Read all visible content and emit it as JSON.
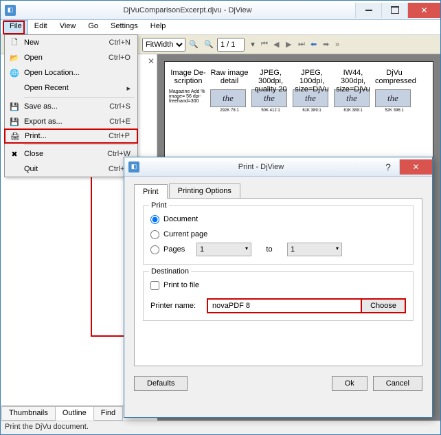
{
  "main": {
    "title": "DjVuComparisonExcerpt.djvu - DjView",
    "statusbar": "Print the DjVu document."
  },
  "menubar": {
    "file": "File",
    "edit": "Edit",
    "view": "View",
    "go": "Go",
    "settings": "Settings",
    "help": "Help"
  },
  "filemenu": {
    "new": {
      "label": "New",
      "shortcut": "Ctrl+N"
    },
    "open": {
      "label": "Open",
      "shortcut": "Ctrl+O"
    },
    "open_location": {
      "label": "Open Location..."
    },
    "open_recent": {
      "label": "Open Recent"
    },
    "save_as": {
      "label": "Save as...",
      "shortcut": "Ctrl+S"
    },
    "export_as": {
      "label": "Export as...",
      "shortcut": "Ctrl+E"
    },
    "print": {
      "label": "Print...",
      "shortcut": "Ctrl+P"
    },
    "close": {
      "label": "Close",
      "shortcut": "Ctrl+W"
    },
    "quit": {
      "label": "Quit",
      "shortcut": "Ctrl+Q"
    }
  },
  "toolbar": {
    "zoom_mode": "FitWidth",
    "page_display": "1 / 1"
  },
  "bottom_tabs": {
    "thumbnails": "Thumbnails",
    "outline": "Outline",
    "find": "Find"
  },
  "document": {
    "cols": [
      {
        "hdr": "Image De-scription",
        "thumb": "",
        "meta": "Magazine Add % image= 56 dpi-freehand=300",
        "meta2": ""
      },
      {
        "hdr": "Raw image detail",
        "thumb": "the",
        "meta": "292K 78:1"
      },
      {
        "hdr": "JPEG, 300dpi, quality 20",
        "thumb": "the",
        "meta": "50K 412:1"
      },
      {
        "hdr": "JPEG, 100dpi, size=DjVu",
        "thumb": "the",
        "meta": "61K 389:1"
      },
      {
        "hdr": "IW44, 300dpi, size=DjVu",
        "thumb": "the",
        "meta": "61K 389:1"
      },
      {
        "hdr": "DjVu compressed",
        "thumb": "the",
        "meta": "52K 396:1"
      }
    ]
  },
  "dialog": {
    "title": "Print - DjView",
    "tabs": {
      "print": "Print",
      "options": "Printing Options"
    },
    "print_group": {
      "legend": "Print",
      "document": "Document",
      "current_page": "Current page",
      "pages": "Pages",
      "page_from": "1",
      "to": "to",
      "page_to": "1"
    },
    "dest_group": {
      "legend": "Destination",
      "print_to_file": "Print to file",
      "printer_name_label": "Printer name:",
      "printer_name": "novaPDF 8",
      "choose": "Choose"
    },
    "buttons": {
      "defaults": "Defaults",
      "ok": "Ok",
      "cancel": "Cancel"
    }
  }
}
